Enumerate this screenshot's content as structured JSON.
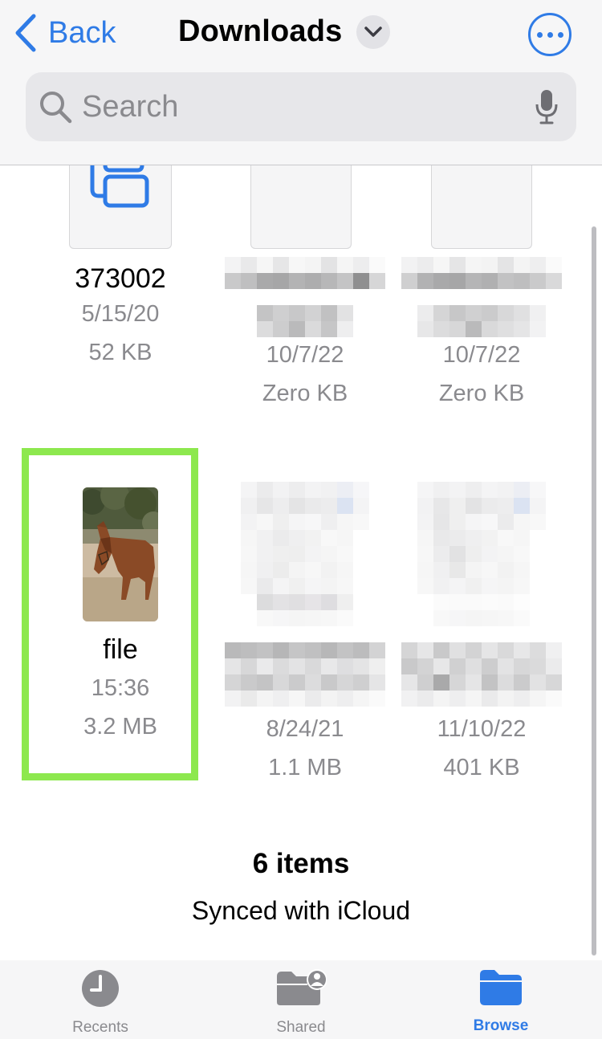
{
  "nav": {
    "back_label": "Back",
    "title": "Downloads",
    "icons": {
      "back": "chevron-left-icon",
      "title_menu": "chevron-down-icon",
      "more": "ellipsis-circle-icon"
    }
  },
  "search": {
    "placeholder": "Search",
    "value": ""
  },
  "files": [
    {
      "name": "373002",
      "date": "5/15/20",
      "size": "52 KB"
    },
    {
      "name": "",
      "date": "10/7/22",
      "size": "Zero KB"
    },
    {
      "name": "",
      "date": "10/7/22",
      "size": "Zero KB"
    },
    {
      "name": "file",
      "date": "15:36",
      "size": "3.2 MB"
    },
    {
      "name": "",
      "date": "8/24/21",
      "size": "1.1 MB"
    },
    {
      "name": "",
      "date": "11/10/22",
      "size": "401 KB"
    }
  ],
  "summary": {
    "count": "6 items",
    "sync": "Synced with iCloud"
  },
  "tabs": [
    {
      "label": "Recents",
      "icon": "clock-icon"
    },
    {
      "label": "Shared",
      "icon": "shared-folder-icon"
    },
    {
      "label": "Browse",
      "icon": "folder-icon"
    }
  ],
  "colors": {
    "accent": "#2f7be6",
    "highlight": "#8de84e",
    "secondary_text": "#8a8a8e",
    "tab_inactive": "#8a8a8e"
  }
}
